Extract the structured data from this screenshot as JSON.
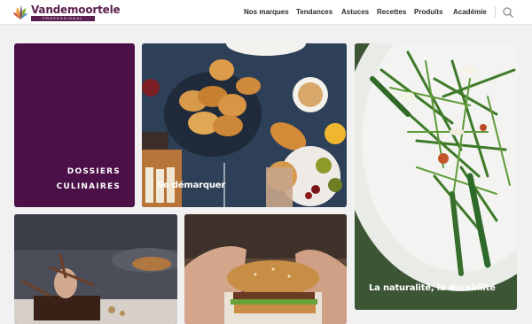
{
  "header": {
    "logo": {
      "brand": "Vandemoortele",
      "subtitle": "PROFESSIONAL"
    },
    "nav": [
      {
        "label": "Nos marques"
      },
      {
        "label": "Tendances"
      },
      {
        "label": "Astuces"
      },
      {
        "label": "Recettes"
      },
      {
        "label": "Produits"
      },
      {
        "label": "Académie"
      }
    ],
    "search_icon": "search-icon"
  },
  "tiles": {
    "dossiers": {
      "line1": "DOSSIERS",
      "line2": "CULINAIRES",
      "color": "#4b1048"
    },
    "demarquer": {
      "label": "Se démarquer"
    },
    "naturalite": {
      "label": "La naturalité, la durabilité"
    },
    "dessert": {
      "label": ""
    },
    "burger": {
      "label": ""
    }
  },
  "colors": {
    "brand": "#5b1f4f",
    "header_bg": "#ffffff",
    "page_bg": "#f1f1f2"
  }
}
